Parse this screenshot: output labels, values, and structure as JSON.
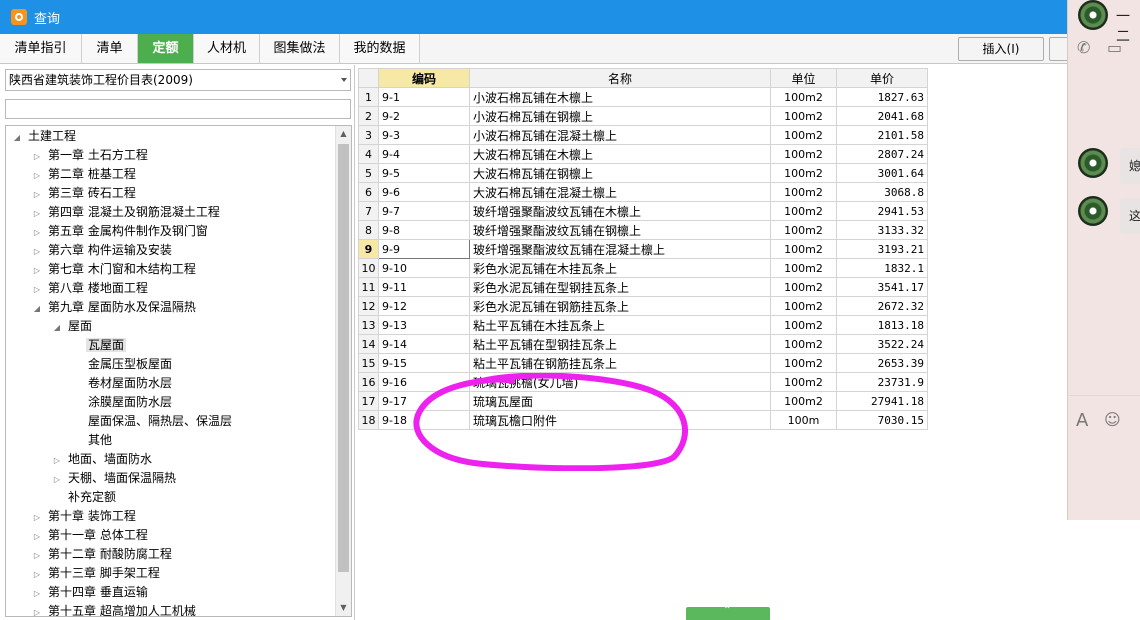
{
  "window": {
    "title": "查询"
  },
  "tabs": [
    "清单指引",
    "清单",
    "定额",
    "人材机",
    "图集做法",
    "我的数据"
  ],
  "active_tab": "定额",
  "toolbar": {
    "insert_label": "插入(I)"
  },
  "left": {
    "library": "陕西省建筑装饰工程价目表(2009)",
    "search_value": "",
    "tree": [
      {
        "label": "土建工程",
        "level": 0,
        "state": "expanded"
      },
      {
        "label": "第一章 土石方工程",
        "level": 1,
        "state": "collapsed"
      },
      {
        "label": "第二章 桩基工程",
        "level": 1,
        "state": "collapsed"
      },
      {
        "label": "第三章 砖石工程",
        "level": 1,
        "state": "collapsed"
      },
      {
        "label": "第四章 混凝土及钢筋混凝土工程",
        "level": 1,
        "state": "collapsed"
      },
      {
        "label": "第五章 金属构件制作及钢门窗",
        "level": 1,
        "state": "collapsed"
      },
      {
        "label": "第六章 构件运输及安装",
        "level": 1,
        "state": "collapsed"
      },
      {
        "label": "第七章 木门窗和木结构工程",
        "level": 1,
        "state": "collapsed"
      },
      {
        "label": "第八章 楼地面工程",
        "level": 1,
        "state": "collapsed"
      },
      {
        "label": "第九章 屋面防水及保温隔热",
        "level": 1,
        "state": "expanded"
      },
      {
        "label": "屋面",
        "level": 2,
        "state": "expanded"
      },
      {
        "label": "瓦屋面",
        "level": 3,
        "state": "leaf",
        "selected": true
      },
      {
        "label": "金属压型板屋面",
        "level": 3,
        "state": "leaf"
      },
      {
        "label": "卷材屋面防水层",
        "level": 3,
        "state": "leaf"
      },
      {
        "label": "涂膜屋面防水层",
        "level": 3,
        "state": "leaf"
      },
      {
        "label": "屋面保温、隔热层、保温层",
        "level": 3,
        "state": "leaf"
      },
      {
        "label": "其他",
        "level": 3,
        "state": "leaf"
      },
      {
        "label": "地面、墙面防水",
        "level": 2,
        "state": "collapsed"
      },
      {
        "label": "天棚、墙面保温隔热",
        "level": 2,
        "state": "collapsed"
      },
      {
        "label": "补充定额",
        "level": 2,
        "state": "leaf"
      },
      {
        "label": "第十章 装饰工程",
        "level": 1,
        "state": "collapsed"
      },
      {
        "label": "第十一章 总体工程",
        "level": 1,
        "state": "collapsed"
      },
      {
        "label": "第十二章 耐酸防腐工程",
        "level": 1,
        "state": "collapsed"
      },
      {
        "label": "第十三章 脚手架工程",
        "level": 1,
        "state": "collapsed"
      },
      {
        "label": "第十四章 垂直运输",
        "level": 1,
        "state": "collapsed"
      },
      {
        "label": "第十五章 超高增加人工机械",
        "level": 1,
        "state": "collapsed"
      }
    ]
  },
  "grid": {
    "headers": [
      "编码",
      "名称",
      "单位",
      "单价"
    ],
    "current_row": 9,
    "rows": [
      {
        "no": "1",
        "code": "9-1",
        "name": "小波石棉瓦铺在木檩上",
        "unit": "100m2",
        "price": "1827.63"
      },
      {
        "no": "2",
        "code": "9-2",
        "name": "小波石棉瓦铺在钢檩上",
        "unit": "100m2",
        "price": "2041.68"
      },
      {
        "no": "3",
        "code": "9-3",
        "name": "小波石棉瓦铺在混凝土檩上",
        "unit": "100m2",
        "price": "2101.58"
      },
      {
        "no": "4",
        "code": "9-4",
        "name": "大波石棉瓦铺在木檩上",
        "unit": "100m2",
        "price": "2807.24"
      },
      {
        "no": "5",
        "code": "9-5",
        "name": "大波石棉瓦铺在钢檩上",
        "unit": "100m2",
        "price": "3001.64"
      },
      {
        "no": "6",
        "code": "9-6",
        "name": "大波石棉瓦铺在混凝土檩上",
        "unit": "100m2",
        "price": "3068.8"
      },
      {
        "no": "7",
        "code": "9-7",
        "name": "玻纤增强聚酯波纹瓦铺在木檩上",
        "unit": "100m2",
        "price": "2941.53"
      },
      {
        "no": "8",
        "code": "9-8",
        "name": "玻纤增强聚酯波纹瓦铺在钢檩上",
        "unit": "100m2",
        "price": "3133.32"
      },
      {
        "no": "9",
        "code": "9-9",
        "name": "玻纤增强聚酯波纹瓦铺在混凝土檩上",
        "unit": "100m2",
        "price": "3193.21"
      },
      {
        "no": "10",
        "code": "9-10",
        "name": "彩色水泥瓦铺在木挂瓦条上",
        "unit": "100m2",
        "price": "1832.1"
      },
      {
        "no": "11",
        "code": "9-11",
        "name": "彩色水泥瓦铺在型钢挂瓦条上",
        "unit": "100m2",
        "price": "3541.17"
      },
      {
        "no": "12",
        "code": "9-12",
        "name": "彩色水泥瓦铺在钢筋挂瓦条上",
        "unit": "100m2",
        "price": "2672.32"
      },
      {
        "no": "13",
        "code": "9-13",
        "name": "粘土平瓦铺在木挂瓦条上",
        "unit": "100m2",
        "price": "1813.18"
      },
      {
        "no": "14",
        "code": "9-14",
        "name": "粘土平瓦铺在型钢挂瓦条上",
        "unit": "100m2",
        "price": "3522.24"
      },
      {
        "no": "15",
        "code": "9-15",
        "name": "粘土平瓦铺在钢筋挂瓦条上",
        "unit": "100m2",
        "price": "2653.39"
      },
      {
        "no": "16",
        "code": "9-16",
        "name": "琉璃瓦挑檐(女儿墙)",
        "unit": "100m2",
        "price": "23731.9"
      },
      {
        "no": "17",
        "code": "9-17",
        "name": "琉璃瓦屋面",
        "unit": "100m2",
        "price": "27941.18"
      },
      {
        "no": "18",
        "code": "9-18",
        "name": "琉璃瓦檐口附件",
        "unit": "100m",
        "price": "7030.15"
      }
    ]
  },
  "chat": {
    "contact_name": "一二",
    "messages": [
      "媳",
      "这"
    ],
    "icons": [
      "phone-icon",
      "video-icon",
      "font-icon",
      "emoji-icon"
    ]
  },
  "colors": {
    "titlebar": "#1e90e6",
    "active_tab": "#4cae4c",
    "annotation": "#ee22ee",
    "header_highlight": "#f6e9a6"
  }
}
